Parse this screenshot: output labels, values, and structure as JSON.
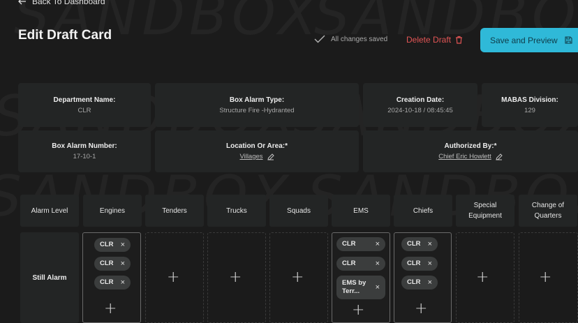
{
  "watermark": [
    "SANDBOX",
    "SANDBOX",
    "SANDBOX",
    "SANDBOX",
    "SANDBOX",
    "SANDBOX"
  ],
  "nav": {
    "back_label": "Back To Dashboard"
  },
  "header": {
    "title": "Edit Draft Card",
    "saved_status": "All changes saved",
    "delete_label": "Delete Draft",
    "save_label": "Save and Preview"
  },
  "info": {
    "department_label": "Department Name:",
    "department_value": "CLR",
    "box_type_label": "Box Alarm Type:",
    "box_type_value": "Structure Fire -Hydranted",
    "creation_label": "Creation Date:",
    "creation_value": "2024-10-18 / 08:45:45",
    "mabas_label": "MABAS Division:",
    "mabas_value": "129",
    "box_number_label": "Box Alarm Number:",
    "box_number_value": "17-10-1",
    "location_label": "Location Or Area:*",
    "location_value": "Villages",
    "authorized_label": "Authorized By:*",
    "authorized_value": "Chief Eric Howlett"
  },
  "grid": {
    "columns": [
      "Alarm Level",
      "Engines",
      "Tenders",
      "Trucks",
      "Squads",
      "EMS",
      "Chiefs",
      "Special Equipment",
      "Change of Quarters"
    ],
    "rows": [
      {
        "level": "Still Alarm",
        "engines": [
          "CLR",
          "CLR",
          "CLR"
        ],
        "ems": [
          "CLR",
          "CLR",
          "EMS by Terr..."
        ],
        "chiefs": [
          "CLR",
          "CLR",
          "CLR"
        ]
      }
    ],
    "remove_glyph": "×",
    "add_glyph": "+"
  },
  "colors": {
    "accent": "#2fb9d8",
    "danger": "#e25555",
    "background": "#1b1b1b",
    "card": "#232525"
  }
}
